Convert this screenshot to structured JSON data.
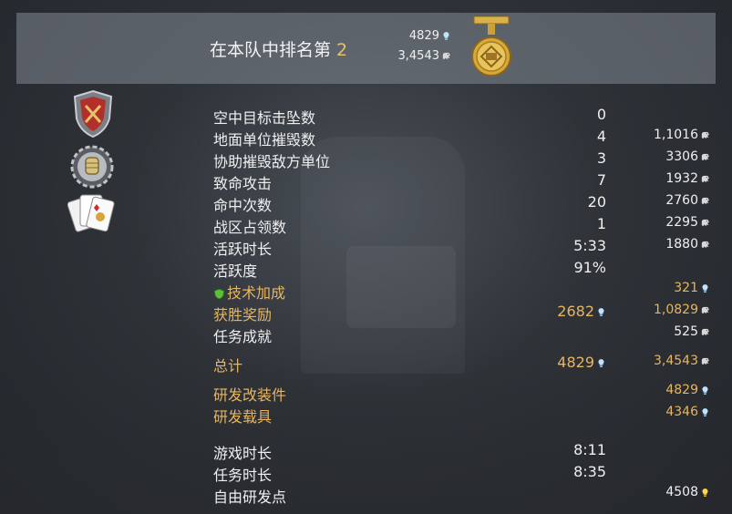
{
  "header": {
    "rank_prefix": "在本队中排名第",
    "rank_number": "2",
    "research_points": "4829",
    "silver_lions": "3,4543"
  },
  "stats": [
    {
      "label": "空中目标击坠数",
      "value": "0",
      "reward": "",
      "reward_icon": ""
    },
    {
      "label": "地面单位摧毁数",
      "value": "4",
      "reward": "1,1016",
      "reward_icon": "silver-lion-icon"
    },
    {
      "label": "协助摧毁敌方单位",
      "value": "3",
      "reward": "3306",
      "reward_icon": "silver-lion-icon"
    },
    {
      "label": "致命攻击",
      "value": "7",
      "reward": "1932",
      "reward_icon": "silver-lion-icon"
    },
    {
      "label": "命中次数",
      "value": "20",
      "reward": "2760",
      "reward_icon": "silver-lion-icon"
    },
    {
      "label": "战区占领数",
      "value": "1",
      "reward": "2295",
      "reward_icon": "silver-lion-icon"
    },
    {
      "label": "活跃时长",
      "value": "5:33",
      "reward": "1880",
      "reward_icon": "silver-lion-icon"
    },
    {
      "label": "活跃度",
      "value": "91%",
      "reward": "",
      "reward_icon": ""
    }
  ],
  "bonus": {
    "tech_label": "技术加成",
    "tech_reward": "321",
    "victory_label": "获胜奖励",
    "victory_rp": "2682",
    "victory_reward": "1,0829",
    "mission_label": "任务成就",
    "mission_reward": "525"
  },
  "total": {
    "label": "总计",
    "rp": "4829",
    "silver": "3,4543"
  },
  "research": {
    "mods_label": "研发改装件",
    "mods_value": "4829",
    "vehicle_label": "研发载具",
    "vehicle_value": "4346"
  },
  "time": {
    "game_label": "游戏时长",
    "game_value": "8:11",
    "mission_label": "任务时长",
    "mission_value": "8:35",
    "free_rp_label": "自由研发点",
    "free_rp_value": "4508"
  },
  "colors": {
    "gold_text": "#e6b560",
    "rank_number": "#e6c36a",
    "header_bg": "#82888f"
  }
}
